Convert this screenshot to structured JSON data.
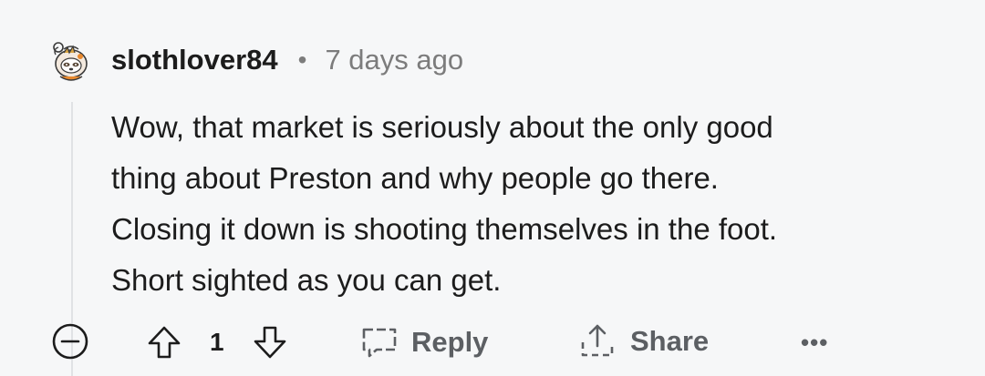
{
  "comment": {
    "username": "slothlover84",
    "separator": "•",
    "timestamp": "7 days ago",
    "body_lines": [
      "Wow, that market is seriously about the only good",
      "thing about Preston and why people go there.",
      "Closing it down is shooting themselves in the foot.",
      "Short sighted as you can get."
    ]
  },
  "actions": {
    "vote_count": "1",
    "reply_label": "Reply",
    "share_label": "Share",
    "more_label": "•••"
  },
  "icons": {
    "avatar": "sloth-avatar-icon",
    "collapse": "collapse-minus-icon",
    "upvote": "upvote-arrow-icon",
    "downvote": "downvote-arrow-icon",
    "reply": "reply-bubble-icon",
    "share": "share-upload-icon",
    "more": "more-dots-icon"
  },
  "colors": {
    "background": "#f6f7f8",
    "text": "#1c1c1c",
    "muted": "#7c7c7c",
    "action": "#5c5f63",
    "thread_line": "#e0e2e5"
  }
}
